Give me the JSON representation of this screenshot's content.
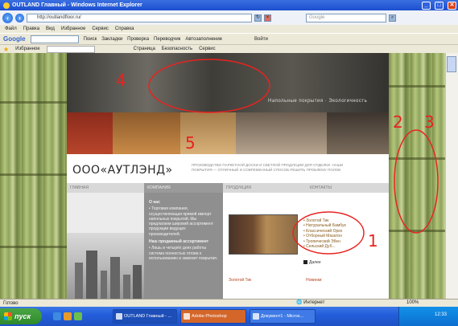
{
  "window": {
    "title": "OUTLAND Главный - Windows Internet Explorer",
    "controls": [
      "_",
      "□",
      "✕"
    ]
  },
  "address_bar": {
    "url": "http://outlandfloor.ru/",
    "search_placeholder": "Google"
  },
  "menu": [
    "Файл",
    "Правка",
    "Вид",
    "Избранное",
    "Сервис",
    "Справка"
  ],
  "google_toolbar": {
    "logo": "Google",
    "items": [
      "Поиск",
      "Закладки",
      "Проверка",
      "Переводчик",
      "Автозаполнение",
      "Войти"
    ]
  },
  "favorites_bar": {
    "favorites_label": "Избранное",
    "right_items": [
      "Страница",
      "Безопасность",
      "Сервис"
    ]
  },
  "site": {
    "hero_nav": "Напольные покрытия  ·  Экологичность",
    "brand": "ООО«АУТЛЭНД»",
    "tagline": "ПРОИЗВОДСТВО ПАРКЕТНОЙ ДОСКИ И СВЕТЛОЙ ПРОДУКЦИИ ДЛЯ ОТДЕЛКИ. НАШИ ПОКРЫТИЯ — ОТЛИЧНЫЙ И СОВРЕМЕННЫЙ СПОСОБ РЕШИТЬ ПРОБЛЕМУ ПОЛОВ",
    "nav": [
      "ГЛАВНАЯ",
      "КОМПАНИЯ",
      "ПРОДУКЦИЯ",
      "КОНТАКТЫ"
    ],
    "company": {
      "heading1": "О нас",
      "text1": "• Торговая компания, осуществляющая прямой импорт напольных покрытий. Мы предлагаем широкий ассортимент продукции ведущих производителей.",
      "heading2": "Наш продажный ассортимент",
      "text2": "• Лишь в четырёх днях работы система полностью готова к использованию и заменит покрытия."
    },
    "products": [
      "Золотой Тик",
      "Натуральный Бамбук",
      "Классический Орех",
      "Отборный Мазатон",
      "Тропический Эбен",
      "Сельский Дуб..."
    ],
    "more_label": "Далее",
    "sub_links": [
      "Золотой Тик",
      "Новинки"
    ]
  },
  "status": {
    "text": "Готово",
    "zone": "Интернет",
    "zoom": "100%"
  },
  "taskbar": {
    "start": "пуск",
    "tasks": [
      "OUTLAND Главный - ...",
      "Adobe Photoshop",
      "Документ1 - Micros..."
    ],
    "clock": "12:33"
  },
  "annotations": [
    "1",
    "2",
    "3",
    "4",
    "5"
  ],
  "colors": {
    "annotation": "#e8231f",
    "titlebar": "#1c4fcf",
    "company_column": "#8f8f8f"
  }
}
